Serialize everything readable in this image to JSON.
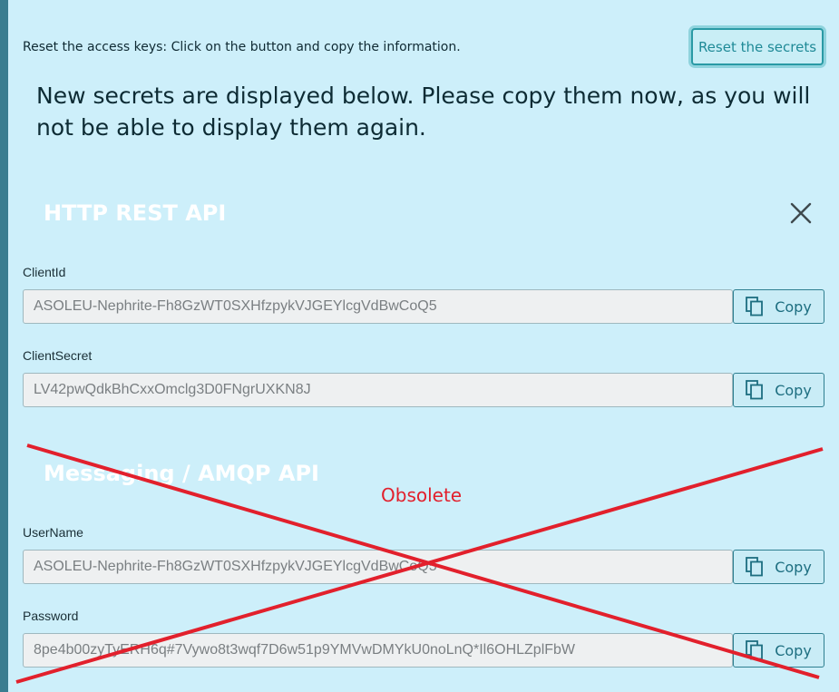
{
  "header": {
    "instruction": "Reset the access keys: Click on the button and copy the information.",
    "reset_button_label": "Reset the secrets"
  },
  "notice": "New secrets are displayed below. Please copy them now, as you will not be able to display them again.",
  "sections": {
    "http": {
      "title": "HTTP REST API",
      "client_id": {
        "label": "ClientId",
        "value": "ASOLEU-Nephrite-Fh8GzWT0SXHfzpykVJGEYlcgVdBwCoQ5"
      },
      "client_secret": {
        "label": "ClientSecret",
        "value": "LV42pwQdkBhCxxOmclg3D0FNgrUXKN8J"
      }
    },
    "amqp": {
      "title": "Messaging / AMQP API",
      "annotation": "Obsolete",
      "username": {
        "label": "UserName",
        "value": "ASOLEU-Nephrite-Fh8GzWT0SXHfzpykVJGEYlcgVdBwCoQ5"
      },
      "password": {
        "label": "Password",
        "value": "8pe4b00zyTyERH6q#7Vywo8t3wqf7D6w51p9YMVwDMYkU0noLnQ*Il6OHLZplFbW"
      }
    }
  },
  "copy_label": "Copy",
  "icons": {
    "close": "close-icon",
    "copy": "copy-icon"
  },
  "colors": {
    "background": "#cdeffa",
    "accent": "#2a9aa5",
    "annotation_red": "#e2202c"
  }
}
